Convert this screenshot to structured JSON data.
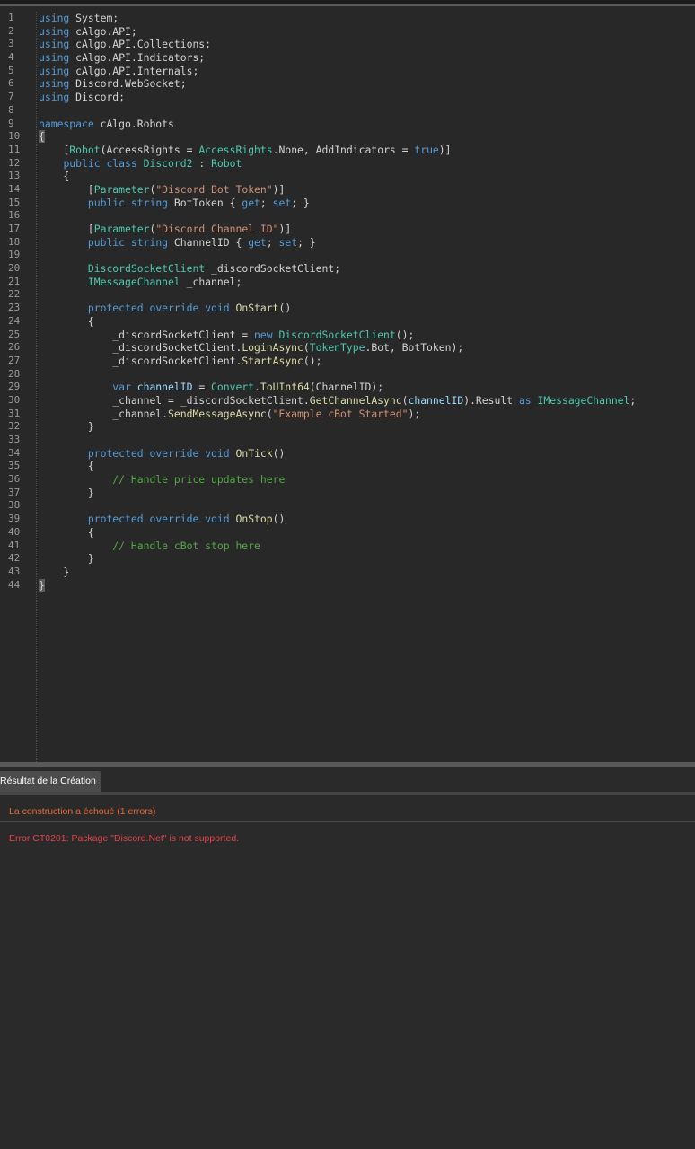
{
  "editor": {
    "lines": [
      {
        "n": "1",
        "tokens": [
          {
            "t": "using",
            "c": "kw"
          },
          {
            "t": " System;",
            "c": "plain"
          }
        ]
      },
      {
        "n": "2",
        "tokens": [
          {
            "t": "using",
            "c": "kw"
          },
          {
            "t": " cAlgo.API;",
            "c": "plain"
          }
        ]
      },
      {
        "n": "3",
        "tokens": [
          {
            "t": "using",
            "c": "kw"
          },
          {
            "t": " cAlgo.API.Collections;",
            "c": "plain"
          }
        ]
      },
      {
        "n": "4",
        "tokens": [
          {
            "t": "using",
            "c": "kw"
          },
          {
            "t": " cAlgo.API.Indicators;",
            "c": "plain"
          }
        ]
      },
      {
        "n": "5",
        "tokens": [
          {
            "t": "using",
            "c": "kw"
          },
          {
            "t": " cAlgo.API.Internals;",
            "c": "plain"
          }
        ]
      },
      {
        "n": "6",
        "tokens": [
          {
            "t": "using",
            "c": "kw"
          },
          {
            "t": " Discord.WebSocket;",
            "c": "plain"
          }
        ]
      },
      {
        "n": "7",
        "tokens": [
          {
            "t": "using",
            "c": "kw"
          },
          {
            "t": " Discord;",
            "c": "plain"
          }
        ]
      },
      {
        "n": "8",
        "tokens": []
      },
      {
        "n": "9",
        "tokens": [
          {
            "t": "namespace",
            "c": "kw"
          },
          {
            "t": " cAlgo.Robots",
            "c": "plain"
          }
        ]
      },
      {
        "n": "10",
        "tokens": [
          {
            "t": "{",
            "c": "brace-hl"
          }
        ]
      },
      {
        "n": "11",
        "tokens": [
          {
            "t": "    [",
            "c": "plain"
          },
          {
            "t": "Robot",
            "c": "type"
          },
          {
            "t": "(AccessRights = ",
            "c": "plain"
          },
          {
            "t": "AccessRights",
            "c": "type"
          },
          {
            "t": ".None, AddIndicators = ",
            "c": "plain"
          },
          {
            "t": "true",
            "c": "kw"
          },
          {
            "t": ")]",
            "c": "plain"
          }
        ]
      },
      {
        "n": "12",
        "tokens": [
          {
            "t": "    ",
            "c": "plain"
          },
          {
            "t": "public",
            "c": "kw"
          },
          {
            "t": " ",
            "c": "plain"
          },
          {
            "t": "class",
            "c": "kw"
          },
          {
            "t": " ",
            "c": "plain"
          },
          {
            "t": "Discord2",
            "c": "type"
          },
          {
            "t": " : ",
            "c": "plain"
          },
          {
            "t": "Robot",
            "c": "type"
          }
        ]
      },
      {
        "n": "13",
        "tokens": [
          {
            "t": "    {",
            "c": "plain"
          }
        ]
      },
      {
        "n": "14",
        "tokens": [
          {
            "t": "        [",
            "c": "plain"
          },
          {
            "t": "Parameter",
            "c": "type"
          },
          {
            "t": "(",
            "c": "plain"
          },
          {
            "t": "\"Discord Bot Token\"",
            "c": "str"
          },
          {
            "t": ")]",
            "c": "plain"
          }
        ]
      },
      {
        "n": "15",
        "tokens": [
          {
            "t": "        ",
            "c": "plain"
          },
          {
            "t": "public",
            "c": "kw"
          },
          {
            "t": " ",
            "c": "plain"
          },
          {
            "t": "string",
            "c": "kw"
          },
          {
            "t": " BotToken { ",
            "c": "plain"
          },
          {
            "t": "get",
            "c": "kw"
          },
          {
            "t": "; ",
            "c": "plain"
          },
          {
            "t": "set",
            "c": "kw"
          },
          {
            "t": "; }",
            "c": "plain"
          }
        ]
      },
      {
        "n": "16",
        "tokens": []
      },
      {
        "n": "17",
        "tokens": [
          {
            "t": "        [",
            "c": "plain"
          },
          {
            "t": "Parameter",
            "c": "type"
          },
          {
            "t": "(",
            "c": "plain"
          },
          {
            "t": "\"Discord Channel ID\"",
            "c": "str"
          },
          {
            "t": ")]",
            "c": "plain"
          }
        ]
      },
      {
        "n": "18",
        "tokens": [
          {
            "t": "        ",
            "c": "plain"
          },
          {
            "t": "public",
            "c": "kw"
          },
          {
            "t": " ",
            "c": "plain"
          },
          {
            "t": "string",
            "c": "kw"
          },
          {
            "t": " ChannelID { ",
            "c": "plain"
          },
          {
            "t": "get",
            "c": "kw"
          },
          {
            "t": "; ",
            "c": "plain"
          },
          {
            "t": "set",
            "c": "kw"
          },
          {
            "t": "; }",
            "c": "plain"
          }
        ]
      },
      {
        "n": "19",
        "tokens": []
      },
      {
        "n": "20",
        "tokens": [
          {
            "t": "        ",
            "c": "plain"
          },
          {
            "t": "DiscordSocketClient",
            "c": "type"
          },
          {
            "t": " _discordSocketClient;",
            "c": "plain"
          }
        ]
      },
      {
        "n": "21",
        "tokens": [
          {
            "t": "        ",
            "c": "plain"
          },
          {
            "t": "IMessageChannel",
            "c": "type"
          },
          {
            "t": " _channel;",
            "c": "plain"
          }
        ]
      },
      {
        "n": "22",
        "tokens": []
      },
      {
        "n": "23",
        "tokens": [
          {
            "t": "        ",
            "c": "plain"
          },
          {
            "t": "protected",
            "c": "kw"
          },
          {
            "t": " ",
            "c": "plain"
          },
          {
            "t": "override",
            "c": "kw"
          },
          {
            "t": " ",
            "c": "plain"
          },
          {
            "t": "void",
            "c": "kw"
          },
          {
            "t": " ",
            "c": "plain"
          },
          {
            "t": "OnStart",
            "c": "fn"
          },
          {
            "t": "()",
            "c": "plain"
          }
        ]
      },
      {
        "n": "24",
        "tokens": [
          {
            "t": "        {",
            "c": "plain"
          }
        ]
      },
      {
        "n": "25",
        "tokens": [
          {
            "t": "            _discordSocketClient = ",
            "c": "plain"
          },
          {
            "t": "new",
            "c": "kw"
          },
          {
            "t": " ",
            "c": "plain"
          },
          {
            "t": "DiscordSocketClient",
            "c": "type"
          },
          {
            "t": "();",
            "c": "plain"
          }
        ]
      },
      {
        "n": "26",
        "tokens": [
          {
            "t": "            _discordSocketClient.",
            "c": "plain"
          },
          {
            "t": "LoginAsync",
            "c": "fn"
          },
          {
            "t": "(",
            "c": "plain"
          },
          {
            "t": "TokenType",
            "c": "type"
          },
          {
            "t": ".Bot, BotToken);",
            "c": "plain"
          }
        ]
      },
      {
        "n": "27",
        "tokens": [
          {
            "t": "            _discordSocketClient.",
            "c": "plain"
          },
          {
            "t": "StartAsync",
            "c": "fn"
          },
          {
            "t": "();",
            "c": "plain"
          }
        ]
      },
      {
        "n": "28",
        "tokens": []
      },
      {
        "n": "29",
        "tokens": [
          {
            "t": "            ",
            "c": "plain"
          },
          {
            "t": "var",
            "c": "kw"
          },
          {
            "t": " ",
            "c": "plain"
          },
          {
            "t": "channelID",
            "c": "var"
          },
          {
            "t": " = ",
            "c": "plain"
          },
          {
            "t": "Convert",
            "c": "type"
          },
          {
            "t": ".",
            "c": "plain"
          },
          {
            "t": "ToUInt64",
            "c": "fn"
          },
          {
            "t": "(ChannelID);",
            "c": "plain"
          }
        ]
      },
      {
        "n": "30",
        "tokens": [
          {
            "t": "            _channel = _discordSocketClient.",
            "c": "plain"
          },
          {
            "t": "GetChannelAsync",
            "c": "fn"
          },
          {
            "t": "(",
            "c": "plain"
          },
          {
            "t": "channelID",
            "c": "var"
          },
          {
            "t": ").Result ",
            "c": "plain"
          },
          {
            "t": "as",
            "c": "kw"
          },
          {
            "t": " ",
            "c": "plain"
          },
          {
            "t": "IMessageChannel",
            "c": "type"
          },
          {
            "t": ";",
            "c": "plain"
          }
        ]
      },
      {
        "n": "31",
        "tokens": [
          {
            "t": "            _channel.",
            "c": "plain"
          },
          {
            "t": "SendMessageAsync",
            "c": "fn"
          },
          {
            "t": "(",
            "c": "plain"
          },
          {
            "t": "\"Example cBot Started\"",
            "c": "str"
          },
          {
            "t": ");",
            "c": "plain"
          }
        ]
      },
      {
        "n": "32",
        "tokens": [
          {
            "t": "        }",
            "c": "plain"
          }
        ]
      },
      {
        "n": "33",
        "tokens": []
      },
      {
        "n": "34",
        "tokens": [
          {
            "t": "        ",
            "c": "plain"
          },
          {
            "t": "protected",
            "c": "kw"
          },
          {
            "t": " ",
            "c": "plain"
          },
          {
            "t": "override",
            "c": "kw"
          },
          {
            "t": " ",
            "c": "plain"
          },
          {
            "t": "void",
            "c": "kw"
          },
          {
            "t": " ",
            "c": "plain"
          },
          {
            "t": "OnTick",
            "c": "fn"
          },
          {
            "t": "()",
            "c": "plain"
          }
        ]
      },
      {
        "n": "35",
        "tokens": [
          {
            "t": "        {",
            "c": "plain"
          }
        ]
      },
      {
        "n": "36",
        "tokens": [
          {
            "t": "            ",
            "c": "plain"
          },
          {
            "t": "// Handle price updates here",
            "c": "com"
          }
        ]
      },
      {
        "n": "37",
        "tokens": [
          {
            "t": "        }",
            "c": "plain"
          }
        ]
      },
      {
        "n": "38",
        "tokens": []
      },
      {
        "n": "39",
        "tokens": [
          {
            "t": "        ",
            "c": "plain"
          },
          {
            "t": "protected",
            "c": "kw"
          },
          {
            "t": " ",
            "c": "plain"
          },
          {
            "t": "override",
            "c": "kw"
          },
          {
            "t": " ",
            "c": "plain"
          },
          {
            "t": "void",
            "c": "kw"
          },
          {
            "t": " ",
            "c": "plain"
          },
          {
            "t": "OnStop",
            "c": "fn"
          },
          {
            "t": "()",
            "c": "plain"
          }
        ]
      },
      {
        "n": "40",
        "tokens": [
          {
            "t": "        {",
            "c": "plain"
          }
        ]
      },
      {
        "n": "41",
        "tokens": [
          {
            "t": "            ",
            "c": "plain"
          },
          {
            "t": "// Handle cBot stop here",
            "c": "com"
          }
        ]
      },
      {
        "n": "42",
        "tokens": [
          {
            "t": "        }",
            "c": "plain"
          }
        ]
      },
      {
        "n": "43",
        "tokens": [
          {
            "t": "    }",
            "c": "plain"
          }
        ]
      },
      {
        "n": "44",
        "tokens": [
          {
            "t": "}",
            "c": "brace-hl"
          }
        ]
      }
    ]
  },
  "output_panel": {
    "tab_label": "Résultat de la Création",
    "build_status": "La construction a échoué (1 errors)",
    "error_message": "Error CT0201: Package \"Discord.Net\" is not supported."
  },
  "colors": {
    "background": "#282828",
    "keyword": "#569cd6",
    "type": "#4ec9b0",
    "string": "#ce9178",
    "comment": "#57a64a",
    "method": "#dcdcaa",
    "variable": "#9cdcfe",
    "build_failed": "#e86a3a",
    "error_text": "#e0444c"
  }
}
